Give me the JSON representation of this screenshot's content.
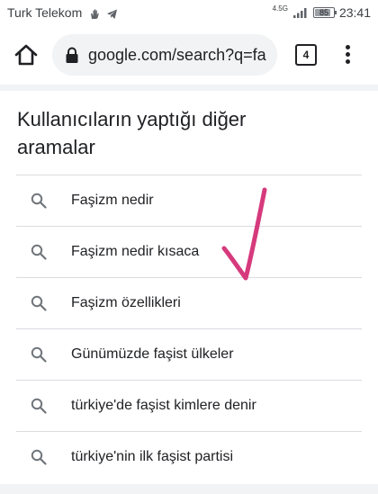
{
  "status_bar": {
    "carrier": "Turk Telekom",
    "network_label": "4.5G",
    "battery": "85",
    "battery_level": 0.85,
    "time": "23:41",
    "icons": [
      "wave-hand-icon",
      "telegram-icon",
      "signal-icon",
      "battery-icon"
    ]
  },
  "browser": {
    "url": "google.com/search?q=fa",
    "tab_count": "4",
    "icons": [
      "home-icon",
      "lock-icon",
      "tabs-icon",
      "more-vert-icon"
    ]
  },
  "related_searches": {
    "title": "Kullanıcıların yaptığı diğer aramalar",
    "items": [
      {
        "label": "Faşizm nedir"
      },
      {
        "label": "Faşizm nedir kısaca"
      },
      {
        "label": "Faşizm özellikleri"
      },
      {
        "label": "Günümüzde faşist ülkeler"
      },
      {
        "label": "türkiye'de faşist kimlere denir"
      },
      {
        "label": "türkiye'nin ilk faşist partisi"
      }
    ]
  },
  "colors": {
    "page_background": "#f1f3f4",
    "card_background": "#ffffff",
    "divider": "#dadce0",
    "annotation_check": "#d63a7d"
  }
}
